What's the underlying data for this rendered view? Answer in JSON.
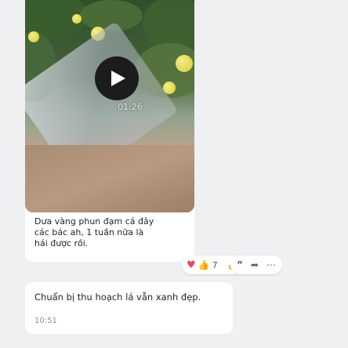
{
  "video_message": {
    "duration": "01:26",
    "caption": "Dưa vàng phun đạm cá đây\ncác bác ah,  1 tuần nữa là\nhái được rồi."
  },
  "reactions": {
    "heart_icon": "heart-icon",
    "thumbs_icon": "thumbs-up-icon",
    "count": "7",
    "like_icon": "like-outline-icon"
  },
  "actions": {
    "quote_icon": "quote-icon",
    "forward_icon": "forward-icon",
    "more_icon": "more-icon"
  },
  "second_message": {
    "text": "Chuẩn bị thu hoạch lá vẫn xanh đẹp.",
    "time": "10:51"
  },
  "colors": {
    "background": "#eef0f2",
    "bubble": "#ffffff",
    "heart": "#e24a5e",
    "play_button": "#1c1c1c"
  }
}
